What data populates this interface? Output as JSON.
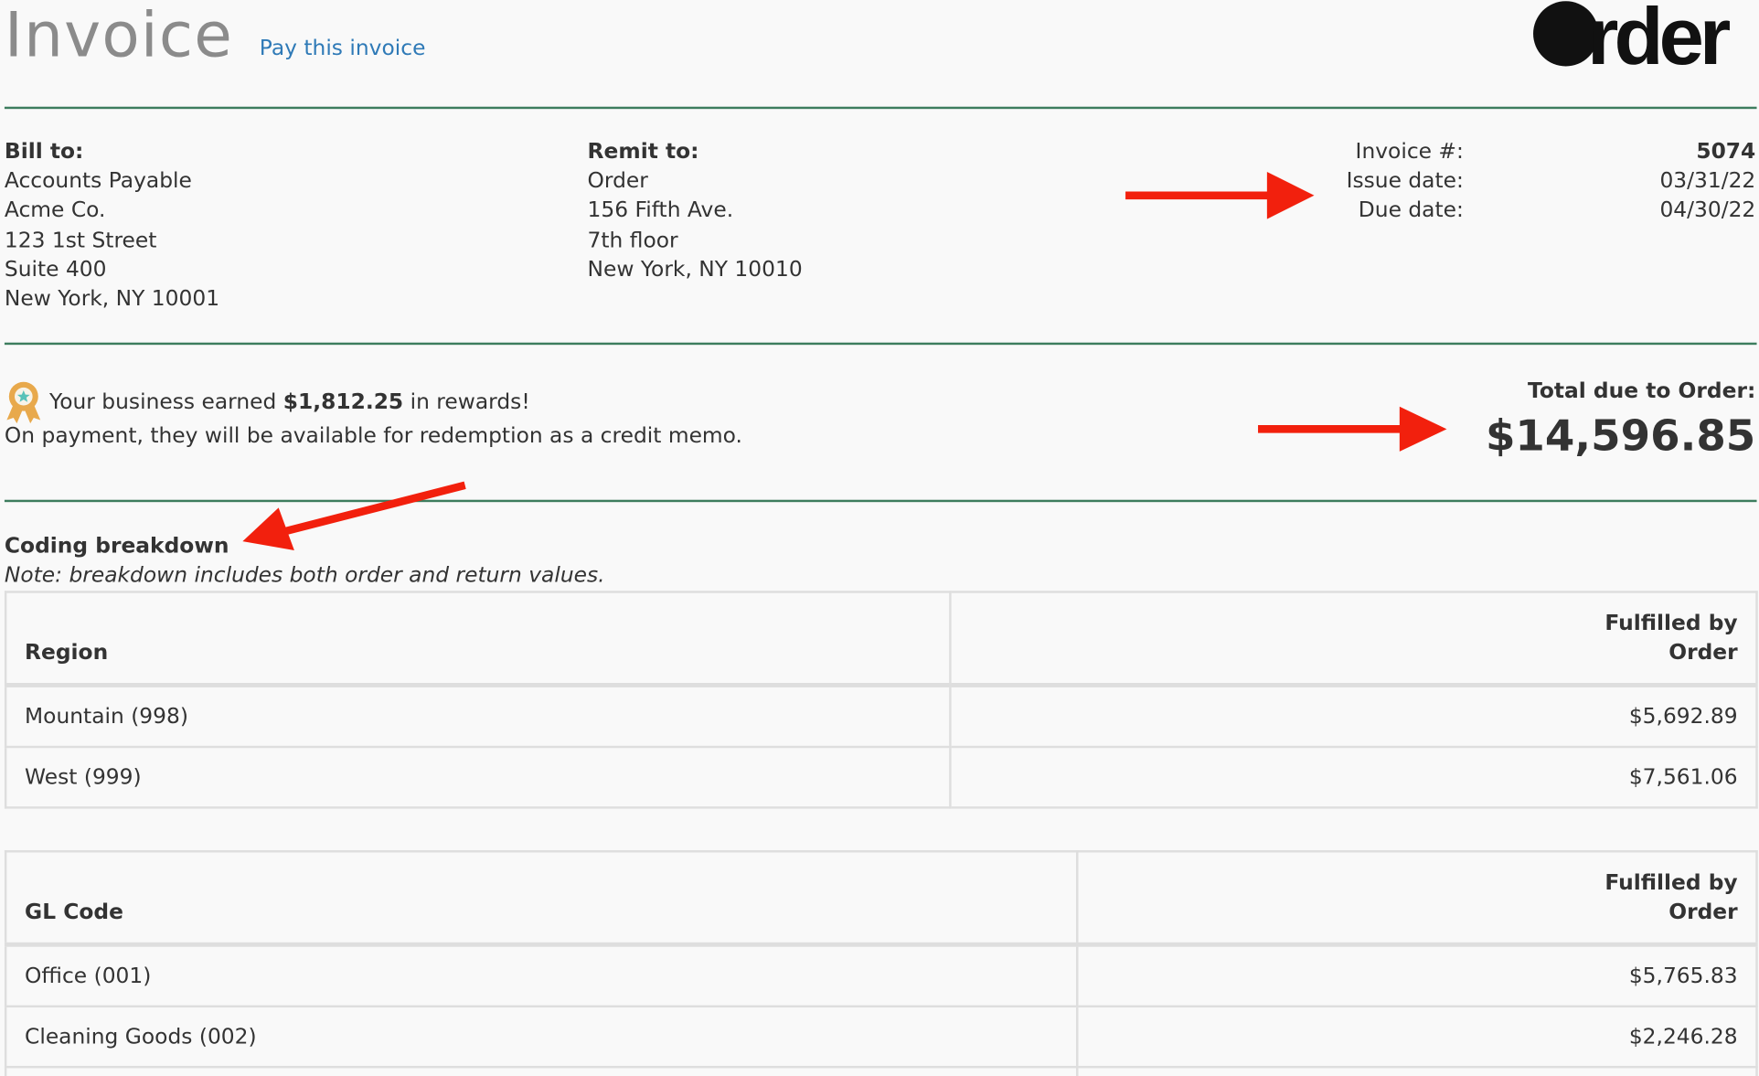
{
  "header": {
    "title": "Invoice",
    "pay_link": "Pay this invoice",
    "logo_text": "Order"
  },
  "bill_to": {
    "label": "Bill to:",
    "lines": [
      "Accounts Payable",
      "Acme Co.",
      "123 1st Street",
      "Suite 400",
      "New York, NY 10001"
    ]
  },
  "remit_to": {
    "label": "Remit to:",
    "lines": [
      "Order",
      "156 Fifth Ave.",
      "7th floor",
      "New York, NY 10010"
    ]
  },
  "invoice_meta": {
    "number_label": "Invoice #:",
    "number": "5074",
    "issue_label": "Issue date:",
    "issue_date": "03/31/22",
    "due_label": "Due date:",
    "due_date": "04/30/22"
  },
  "rewards": {
    "prefix": "Your business earned",
    "amount": "$1,812.25",
    "suffix": "in rewards!",
    "note": "On payment, they will be available for redemption as a credit memo."
  },
  "total": {
    "label": "Total due to Order:",
    "amount": "$14,596.85"
  },
  "coding": {
    "title": "Coding breakdown",
    "note": "Note: breakdown includes both order and return values.",
    "region_table": {
      "col1": "Region",
      "col2_line1": "Fulfilled by",
      "col2_line2": "Order",
      "rows": [
        {
          "name": "Mountain (998)",
          "amount": "$5,692.89"
        },
        {
          "name": "West (999)",
          "amount": "$7,561.06"
        }
      ]
    },
    "gl_table": {
      "col1": "GL Code",
      "col2_line1": "Fulfilled by",
      "col2_line2": "Order",
      "rows": [
        {
          "name": "Office (001)",
          "amount": "$5,765.83"
        },
        {
          "name": "Cleaning Goods (002)",
          "amount": "$2,246.28"
        }
      ]
    }
  },
  "colors": {
    "divider": "#3d7d5e",
    "link": "#2f7ab7",
    "annotation_arrow": "#f2200d",
    "title_gray": "#8b8b8b",
    "rewards_badge": "#e8a94c"
  }
}
